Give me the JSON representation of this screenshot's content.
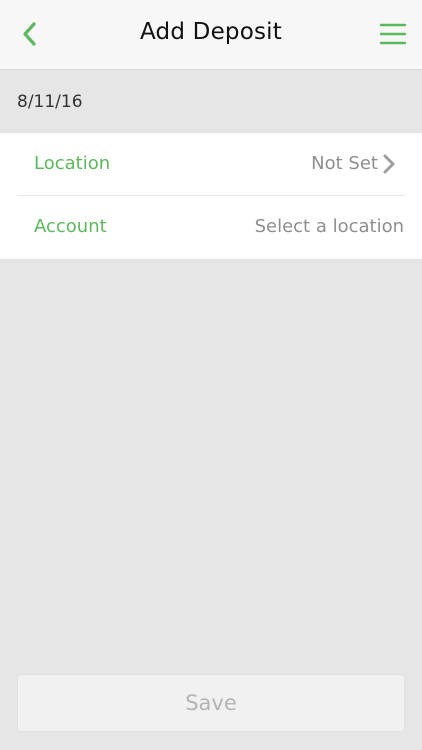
{
  "header": {
    "title": "Add Deposit",
    "back_icon": "chevron-left-icon",
    "menu_icon": "hamburger-menu-icon"
  },
  "date": "8/11/16",
  "form": {
    "location": {
      "label": "Location",
      "value": "Not Set",
      "icon": "chevron-right-icon"
    },
    "account": {
      "label": "Account",
      "value": "Select a location"
    }
  },
  "footer": {
    "save_label": "Save"
  },
  "colors": {
    "accent": "#5cb85c",
    "background": "#e6e6e6",
    "muted_text": "#8e8e8e",
    "disabled_text": "#b5b5b5"
  }
}
